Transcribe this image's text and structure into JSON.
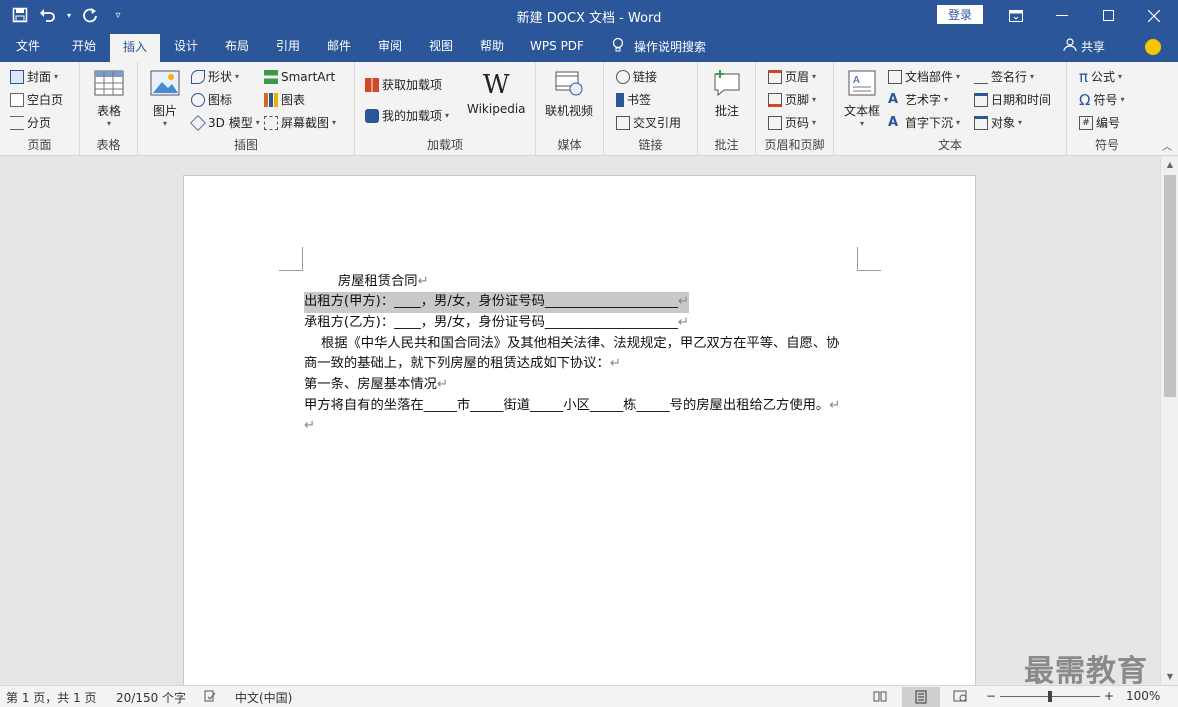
{
  "titlebar": {
    "title": "新建 DOCX 文档  -  Word",
    "login": "登录"
  },
  "tabs": [
    "文件",
    "开始",
    "插入",
    "设计",
    "布局",
    "引用",
    "邮件",
    "审阅",
    "视图",
    "帮助",
    "WPS PDF"
  ],
  "active_tab": "插入",
  "tell_me": "操作说明搜索",
  "share": "共享",
  "ribbon": {
    "page": {
      "label": "页面",
      "cover": "封面",
      "blank": "空白页",
      "break": "分页"
    },
    "table": {
      "label": "表格",
      "button": "表格"
    },
    "illustrations": {
      "label": "插图",
      "picture": "图片",
      "shapes": "形状",
      "icons": "图标",
      "model3d": "3D 模型",
      "smartart": "SmartArt",
      "chart": "图表",
      "screenshot": "屏幕截图"
    },
    "addins": {
      "label": "加载项",
      "get": "获取加载项",
      "my": "我的加载项",
      "wikipedia": "Wikipedia"
    },
    "media": {
      "label": "媒体",
      "video": "联机视频"
    },
    "links": {
      "label": "链接",
      "link": "链接",
      "bookmark": "书签",
      "crossref": "交叉引用"
    },
    "comments": {
      "label": "批注",
      "comment": "批注"
    },
    "headerfooter": {
      "label": "页眉和页脚",
      "header": "页眉",
      "footer": "页脚",
      "pagenum": "页码"
    },
    "text": {
      "label": "文本",
      "textbox": "文本框",
      "parts": "文档部件",
      "wordart": "艺术字",
      "dropcap": "首字下沉",
      "sigline": "签名行",
      "datetime": "日期和时间",
      "object": "对象"
    },
    "symbols": {
      "label": "符号",
      "equation": "公式",
      "symbol": "符号",
      "number": "编号"
    }
  },
  "document": {
    "lines": [
      "        房屋租赁合同",
      "出租方(甲方)：____，男/女，身份证号码____________________",
      "承租方(乙方)：____，男/女，身份证号码____________________",
      "    根据《中华人民共和国合同法》及其他相关法律、法规规定，甲乙双方在平等、自愿、协",
      "商一致的基础上，就下列房屋的租赁达成如下协议：",
      "第一条、房屋基本情况",
      "甲方将自有的坐落在_____市_____街道_____小区_____栋_____号的房屋出租给乙方使用。",
      ""
    ],
    "paragraph_mark": "↵"
  },
  "statusbar": {
    "page": "第 1 页，共 1 页",
    "words": "20/150 个字",
    "language": "中文(中国)",
    "zoom": "100%",
    "zoom_minus": "−",
    "zoom_plus": "+"
  },
  "watermark": "最需教育",
  "colors": {
    "accent": "#2b579a",
    "ribbon_bg": "#f3f3f3",
    "doc_bg": "#e6e6e6",
    "highlight": "#c9c9c9"
  }
}
